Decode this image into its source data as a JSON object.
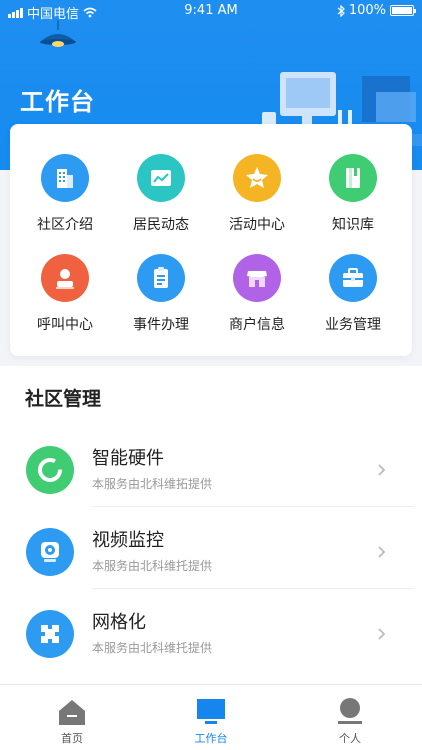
{
  "status_bar": {
    "carrier": "中国电信",
    "time": "9:41 AM",
    "battery": "100%"
  },
  "header": {
    "title": "工作台"
  },
  "shortcuts": [
    {
      "label": "社区介绍",
      "icon": "building-icon",
      "color": "#2e9bf2"
    },
    {
      "label": "居民动态",
      "icon": "chart-icon",
      "color": "#2bc6c4"
    },
    {
      "label": "活动中心",
      "icon": "star-icon",
      "color": "#f5b423"
    },
    {
      "label": "知识库",
      "icon": "book-icon",
      "color": "#3fcc72"
    },
    {
      "label": "呼叫中心",
      "icon": "person-icon",
      "color": "#f0613f"
    },
    {
      "label": "事件办理",
      "icon": "clipboard-icon",
      "color": "#2e9bf2"
    },
    {
      "label": "商户信息",
      "icon": "store-icon",
      "color": "#b063e6"
    },
    {
      "label": "业务管理",
      "icon": "briefcase-icon",
      "color": "#2e9bf2"
    }
  ],
  "section": {
    "title": "社区管理",
    "items": [
      {
        "title": "智能硬件",
        "subtitle": "本服务由北科维拓提供",
        "icon": "ring-icon",
        "color": "#3fcc72"
      },
      {
        "title": "视频监控",
        "subtitle": "本服务由北科维托提供",
        "icon": "camera-icon",
        "color": "#2e9bf2"
      },
      {
        "title": "网格化",
        "subtitle": "本服务由北科维托提供",
        "icon": "grid-icon",
        "color": "#2e9bf2"
      }
    ]
  },
  "tabbar": {
    "tabs": [
      {
        "label": "首页",
        "icon": "home-icon"
      },
      {
        "label": "工作台",
        "icon": "monitor-icon",
        "active": true
      },
      {
        "label": "个人",
        "icon": "user-icon"
      }
    ]
  },
  "colors": {
    "primary": "#1785ee",
    "header_bg": "#1f8ef1"
  }
}
